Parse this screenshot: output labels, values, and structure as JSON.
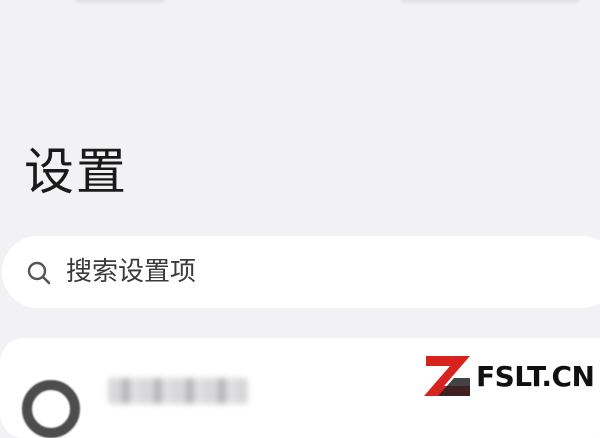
{
  "page": {
    "title": "设置"
  },
  "search": {
    "icon": "search-icon",
    "placeholder": "搜索设置项",
    "value": ""
  },
  "account_card": {
    "avatar_icon": "avatar-icon"
  },
  "watermark": {
    "text": "FSLT.CN",
    "brand_color": "#d7231d"
  }
}
